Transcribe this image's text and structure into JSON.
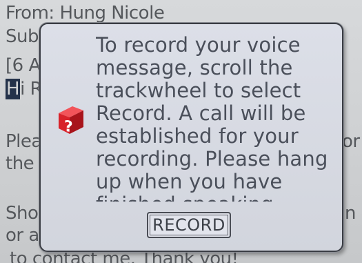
{
  "background_message": {
    "from_line": "From: Hung Nicole",
    "subject_line": "Sub",
    "attachment_line": "[6 A",
    "greeting_cursor": "H",
    "greeting_rest": "i R",
    "body_line1_left": "Plea",
    "body_line1_right": "or",
    "body_line2_left": "the",
    "body_line3_left": "Sho",
    "body_line3_right": "n",
    "body_line4_left": "or a",
    "body_line5": "to contact me. Thank you!"
  },
  "dialog": {
    "icon": "question-mark-icon",
    "message_lines": [
      "To record your voice",
      "message, scroll the",
      "trackwheel to select",
      "Record. A call will be",
      "established for your",
      "recording. Please hang",
      "up when you have",
      "finished speaking."
    ],
    "record_label": "RECORD"
  },
  "colors": {
    "dialog_background": "#d6d9e1",
    "dialog_border": "#3a3d44",
    "icon_red": "#d8222a",
    "text": "#4a4f5a"
  }
}
